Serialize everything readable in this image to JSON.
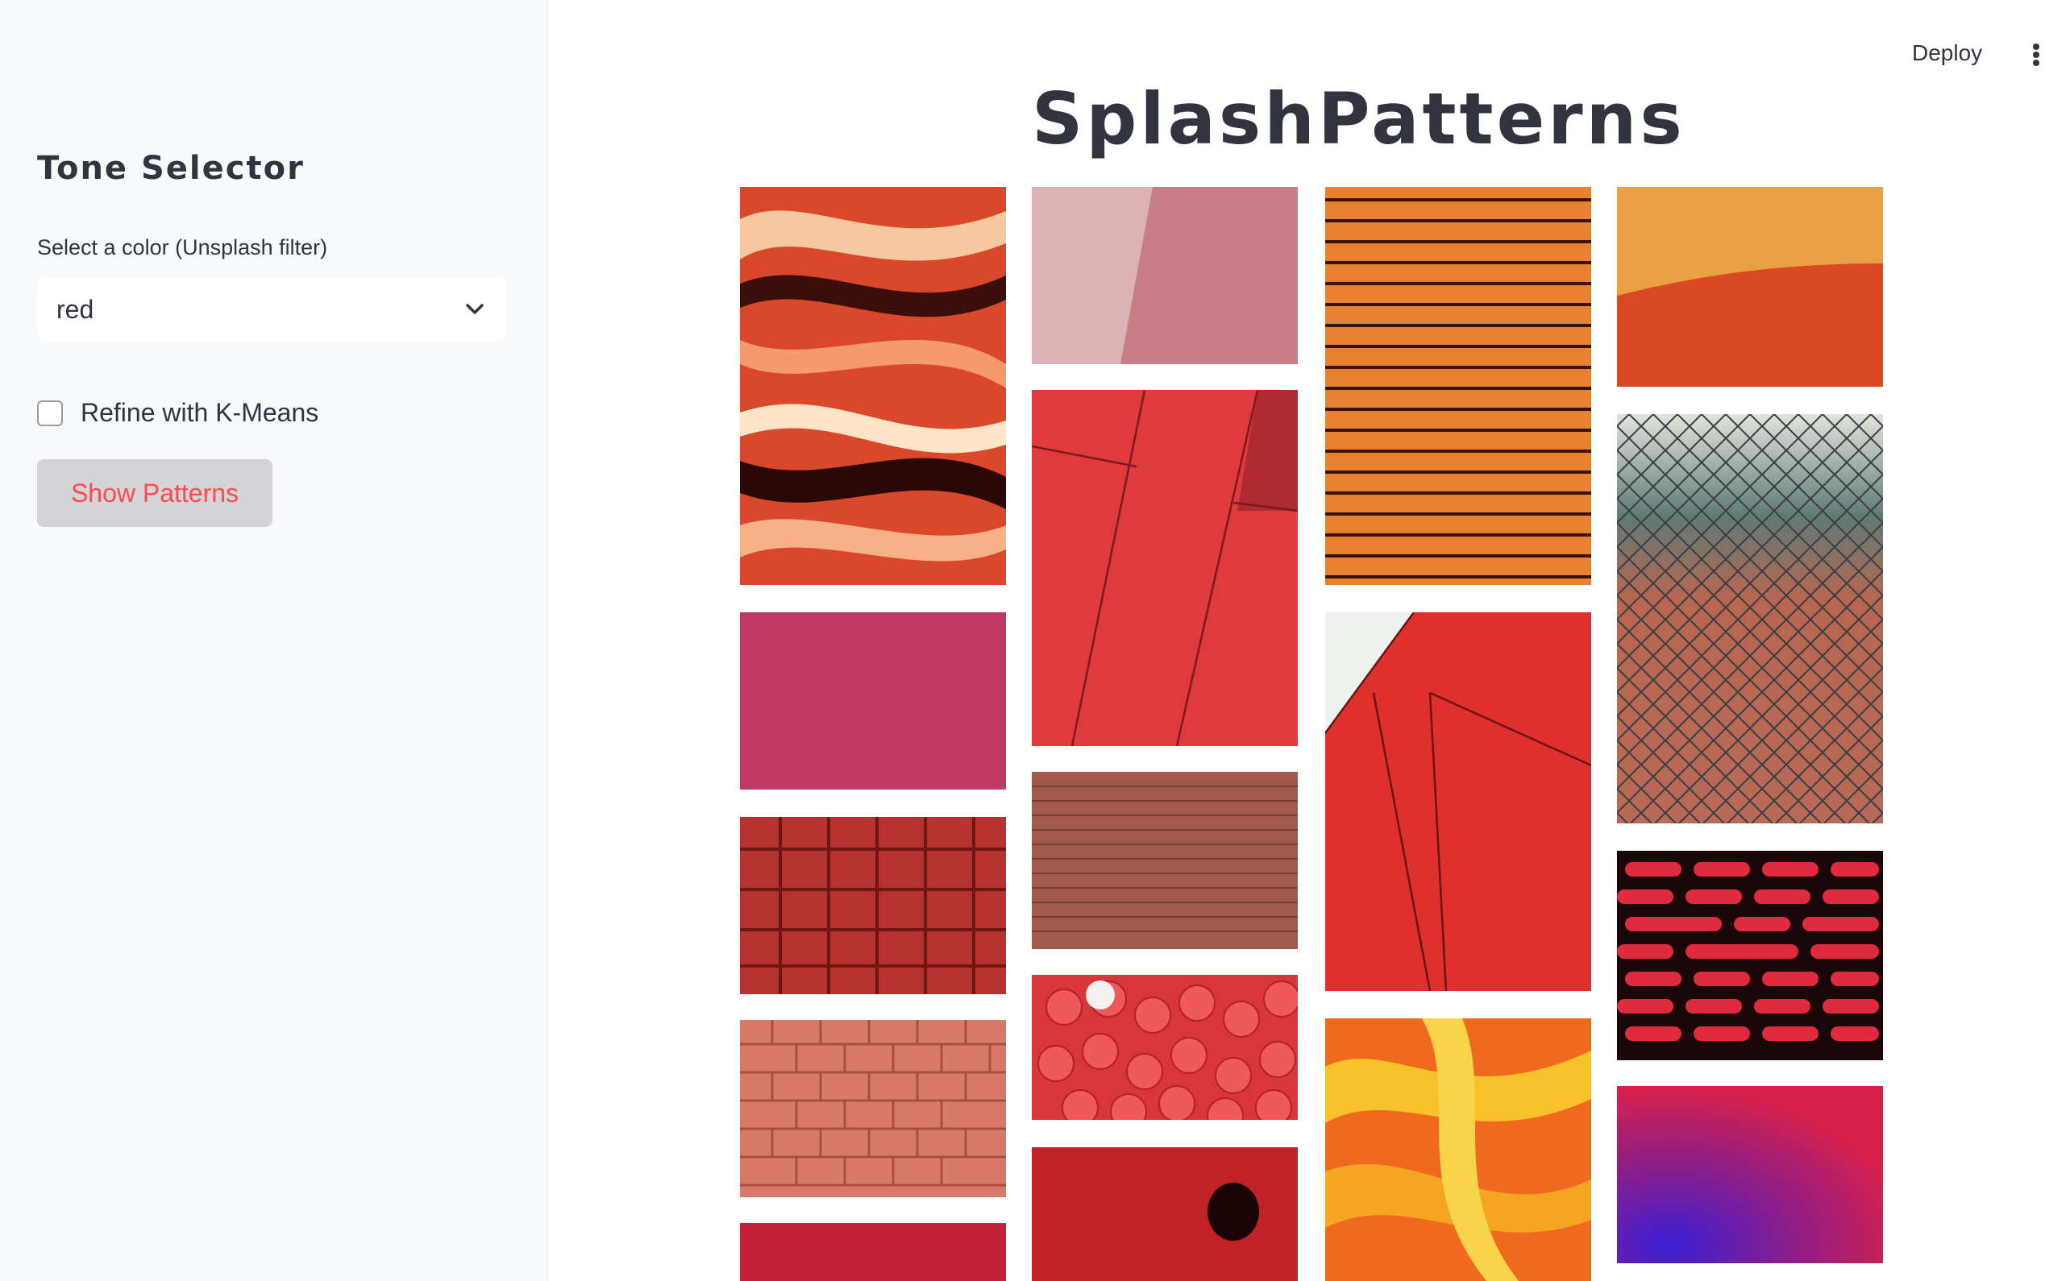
{
  "header": {
    "deploy_label": "Deploy",
    "menu_icon": "kebab-menu-icon"
  },
  "sidebar": {
    "title": "Tone Selector",
    "color_select": {
      "label": "Select a color (Unsplash filter)",
      "value": "red",
      "icon": "chevron-down-icon"
    },
    "kmeans_checkbox": {
      "label": "Refine with K-Means",
      "checked": false
    },
    "show_button_label": "Show Patterns"
  },
  "main": {
    "title": "SplashPatterns"
  },
  "colors": {
    "accent": "#ff4b4b",
    "text": "#31333f",
    "sidebar_bg": "#f8f9fb"
  }
}
